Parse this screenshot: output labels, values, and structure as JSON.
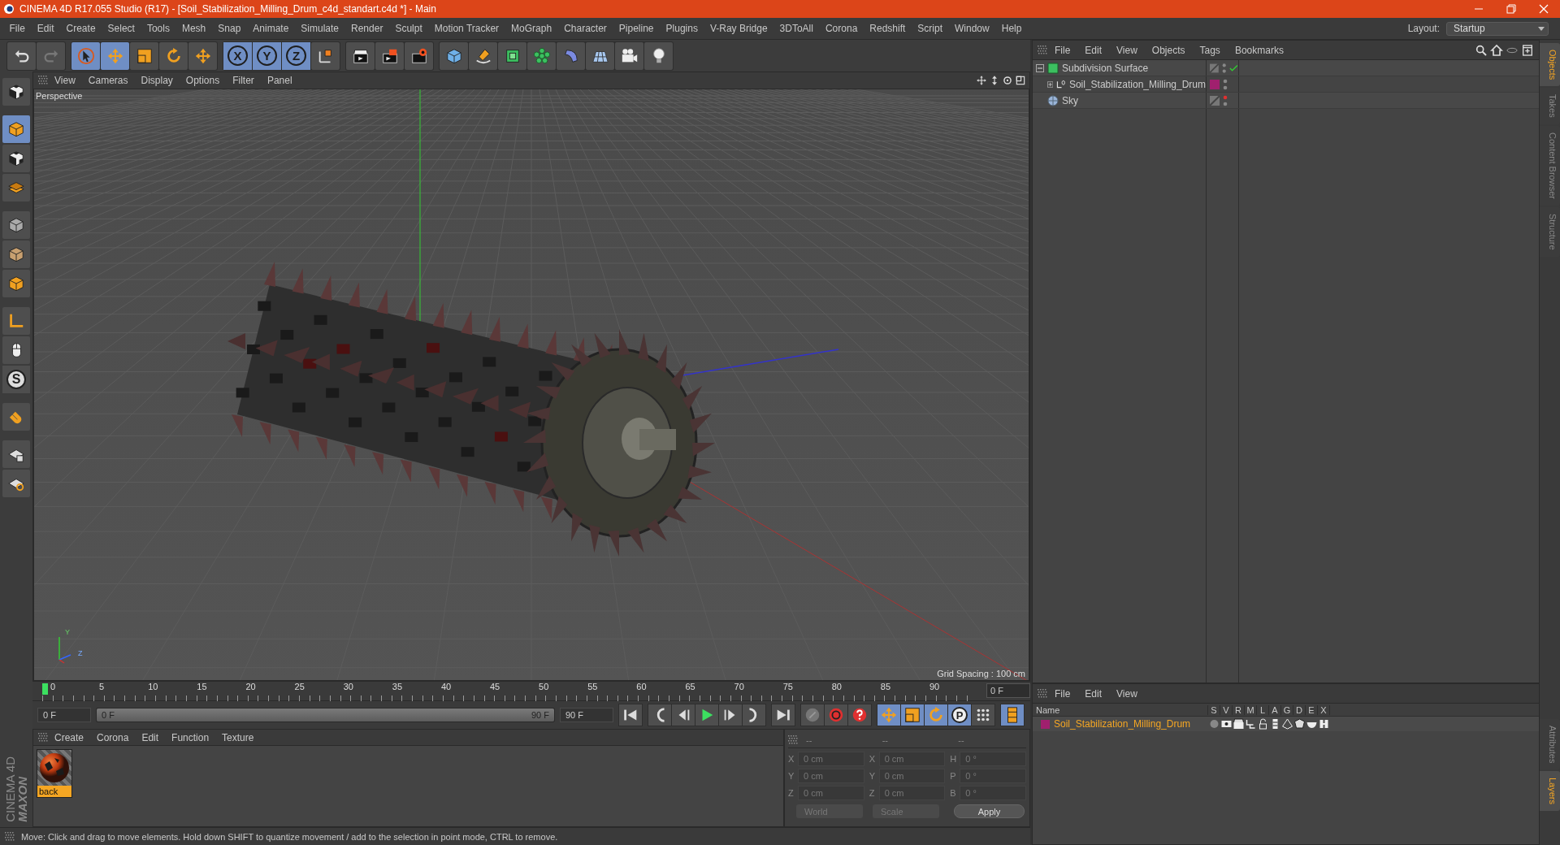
{
  "window": {
    "title": "CINEMA 4D R17.055 Studio (R17) - [Soil_Stabilization_Milling_Drum_c4d_standart.c4d *] - Main"
  },
  "menu": [
    "File",
    "Edit",
    "Create",
    "Select",
    "Tools",
    "Mesh",
    "Snap",
    "Animate",
    "Simulate",
    "Render",
    "Sculpt",
    "Motion Tracker",
    "MoGraph",
    "Character",
    "Pipeline",
    "Plugins",
    "V-Ray Bridge",
    "3DToAll",
    "Corona",
    "Redshift",
    "Script",
    "Window",
    "Help"
  ],
  "layout": {
    "label": "Layout:",
    "value": "Startup"
  },
  "toolbar": {
    "axis_buttons": [
      "X",
      "Y",
      "Z"
    ]
  },
  "left_toolbar": {
    "snap_letter": "S"
  },
  "viewport": {
    "menu": [
      "View",
      "Cameras",
      "Display",
      "Options",
      "Filter",
      "Panel"
    ],
    "camera": "Perspective",
    "grid_spacing": "Grid Spacing : 100 cm",
    "gizmo_labels": [
      "Y",
      "Z"
    ]
  },
  "timeline": {
    "ticks": [
      "0",
      "5",
      "10",
      "15",
      "20",
      "25",
      "30",
      "35",
      "40",
      "45",
      "50",
      "55",
      "60",
      "65",
      "70",
      "75",
      "80",
      "85",
      "90"
    ],
    "current_frame": "0 F",
    "start_field": "0 F",
    "range_slider": {
      "start": "0 F",
      "end": "90 F",
      "level": 1
    },
    "end_field": "90 F",
    "key_letter": "P"
  },
  "material_manager": {
    "menu": [
      "Create",
      "Corona",
      "Edit",
      "Function",
      "Texture"
    ],
    "materials": [
      {
        "name": "back",
        "selected": true
      }
    ]
  },
  "brand": {
    "line1": "MAXON",
    "line2": "CINEMA 4D"
  },
  "coordinates": {
    "disabled": true,
    "headers": [
      "--",
      "--",
      "--"
    ],
    "columns": [
      [
        {
          "axis": "X",
          "value": "0 cm"
        },
        {
          "axis": "Y",
          "value": "0 cm"
        },
        {
          "axis": "Z",
          "value": "0 cm"
        }
      ],
      [
        {
          "axis": "X",
          "value": "0 cm"
        },
        {
          "axis": "Y",
          "value": "0 cm"
        },
        {
          "axis": "Z",
          "value": "0 cm"
        }
      ],
      [
        {
          "axis": "H",
          "value": "0 °"
        },
        {
          "axis": "P",
          "value": "0 °"
        },
        {
          "axis": "B",
          "value": "0 °"
        }
      ]
    ],
    "dropdowns": [
      "World",
      "Scale"
    ],
    "apply": "Apply"
  },
  "object_manager": {
    "menu": [
      "File",
      "Edit",
      "View",
      "Objects",
      "Tags",
      "Bookmarks"
    ],
    "objects": [
      {
        "name": "Subdivision Surface",
        "kind": "subdivision",
        "expanded": true,
        "children": [
          {
            "name": "Soil_Stabilization_Milling_Drum",
            "kind": "null",
            "expanded": false,
            "color": "#a0206e"
          }
        ]
      },
      {
        "name": "Sky",
        "kind": "sky"
      }
    ]
  },
  "layer_manager": {
    "menu": [
      "File",
      "Edit",
      "View"
    ],
    "columns": [
      "Name",
      "S",
      "V",
      "R",
      "M",
      "L",
      "A",
      "G",
      "D",
      "E",
      "X"
    ],
    "layers": [
      {
        "name": "Soil_Stabilization_Milling_Drum",
        "color": "#a0206e"
      }
    ]
  },
  "side_tabs": [
    {
      "label": "Objects",
      "selected": true
    },
    {
      "label": "Takes",
      "selected": false
    },
    {
      "label": "Content Browser",
      "selected": false
    },
    {
      "label": "Structure",
      "selected": false
    }
  ],
  "side_tabs_bottom": [
    {
      "label": "Attributes",
      "selected": false
    },
    {
      "label": "Layers",
      "selected": true
    }
  ],
  "status_bar": "Move: Click and drag to move elements. Hold down SHIFT to quantize movement / add to the selection in point mode, CTRL to remove."
}
